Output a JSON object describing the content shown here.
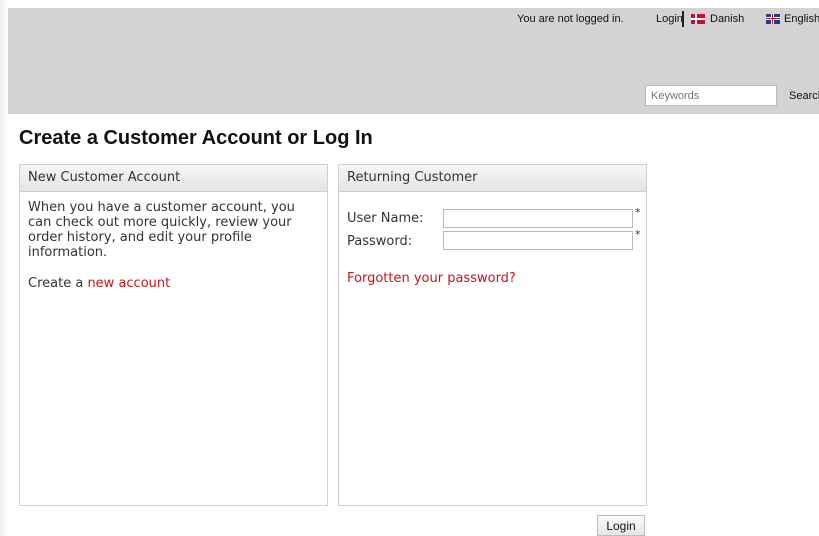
{
  "header": {
    "login_status": "You are not logged in.",
    "login_link": "Login",
    "languages": [
      "Danish",
      "English"
    ],
    "search": {
      "placeholder": "Keywords",
      "button_label": "Search"
    }
  },
  "page_title": "Create a Customer Account or Log In",
  "new_customer": {
    "heading": "New Customer Account",
    "intro": "When you have a customer account, you can check out more quickly, review your order history, and edit your profile information.",
    "create_prefix": "Create a ",
    "create_link": "new account"
  },
  "returning_customer": {
    "heading": "Returning Customer",
    "username_label": "User Name:",
    "password_label": "Password:",
    "required_marker": "*",
    "forgot_link": "Forgotten your password?"
  },
  "login_button": "Login",
  "colors": {
    "header_bg": "#d3d3d3",
    "link_red": "#c4161c"
  }
}
